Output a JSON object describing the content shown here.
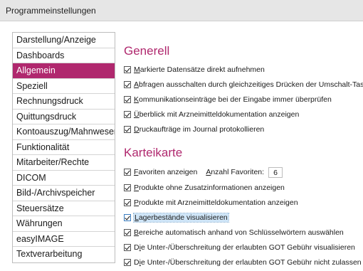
{
  "window": {
    "title": "Programmeinstellungen"
  },
  "sidebar": {
    "items": [
      {
        "label": "Darstellung/Anzeige"
      },
      {
        "label": "Dashboards"
      },
      {
        "label": "Allgemein",
        "active": true
      },
      {
        "label": "Speziell"
      },
      {
        "label": "Rechnungsdruck"
      },
      {
        "label": "Quittungsdruck"
      },
      {
        "label": "Kontoauszug/Mahnwesen"
      },
      {
        "label": "Funktionalität"
      },
      {
        "label": "Mitarbeiter/Rechte"
      },
      {
        "label": "DICOM"
      },
      {
        "label": "Bild-/Archivspeicher"
      },
      {
        "label": "Steuersätze"
      },
      {
        "label": "Währungen"
      },
      {
        "label": "easyIMAGE"
      },
      {
        "label": "Textverarbeitung"
      }
    ],
    "active_color": "#b0286e"
  },
  "generell": {
    "title": "Generell",
    "options": [
      {
        "accel": "M",
        "rest": "arkierte Datensätze direkt aufnehmen",
        "checked": true
      },
      {
        "accel": "A",
        "rest": "bfragen ausschalten durch gleichzeitiges Drücken der Umschalt-Taste",
        "checked": true
      },
      {
        "accel": "K",
        "rest": "ommunikationseinträge bei der Eingabe immer überprüfen",
        "checked": true
      },
      {
        "accel": "Ü",
        "rest": "berblick mit Arzneimitteldokumentation anzeigen",
        "checked": true
      },
      {
        "accel": "D",
        "rest": "ruckaufträge im Journal protokollieren",
        "checked": true
      }
    ]
  },
  "karteikarte": {
    "title": "Karteikarte",
    "favoriten": {
      "accel": "F",
      "rest": "avoriten anzeigen",
      "checked": true
    },
    "anzahl": {
      "accel": "A",
      "rest": "nzahl Favoriten:",
      "value": "6"
    },
    "options": [
      {
        "accel": "P",
        "rest": "rodukte ohne Zusatzinformationen anzeigen",
        "checked": true
      },
      {
        "accel": "P",
        "rest": "rodukte mit Arzneimitteldokumentation anzeigen",
        "checked": true
      },
      {
        "accel": "L",
        "rest": "agerbestände visualisieren",
        "checked": true,
        "focused": true
      },
      {
        "accel": "B",
        "rest": "ereiche automatisch anhand von Schlüsselwörtern auswählen",
        "checked": true
      },
      {
        "accel": "i",
        "pre": "D",
        "rest": "e Unter-/Überschreitung der erlaubten GOT Gebühr visualisieren",
        "checked": true
      },
      {
        "accel": "i",
        "pre": "D",
        "rest": "e Unter-/Überschreitung der erlaubten GOT Gebühr nicht zulassen",
        "checked": true
      }
    ]
  }
}
